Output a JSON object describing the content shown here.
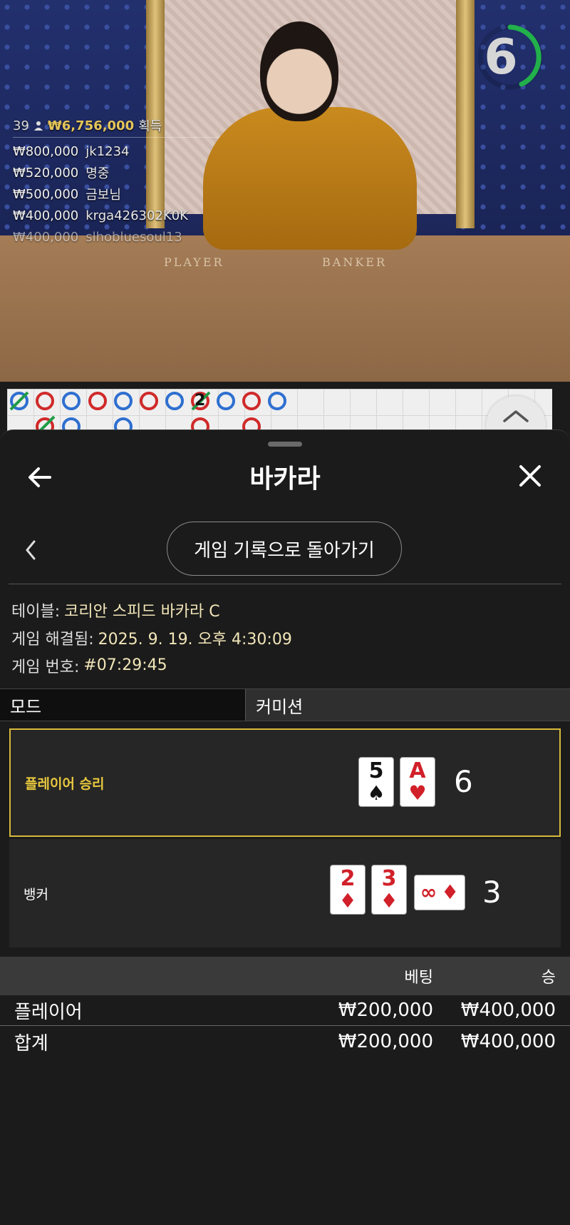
{
  "live": {
    "countdown": "6",
    "table_labels": {
      "player": "PLAYER",
      "banker": "BANKER"
    },
    "winners": {
      "count": "39",
      "total": "₩6,756,000",
      "suffix": "획득",
      "list": [
        {
          "amount": "₩800,000",
          "name": "jk1234"
        },
        {
          "amount": "₩520,000",
          "name": "명중"
        },
        {
          "amount": "₩500,000",
          "name": "금보님"
        },
        {
          "amount": "₩400,000",
          "name": "krga426302K0K"
        },
        {
          "amount": "₩400,000",
          "name": "slhobluesoul13"
        }
      ]
    }
  },
  "roadmap": {
    "marker_number": "2"
  },
  "sheet": {
    "title": "바카라",
    "back_to_history": "게임 기록으로 돌아가기",
    "meta": {
      "table_label": "테이블:",
      "table_value": "코리안 스피드 바카라 C",
      "resolved_label": "게임 해결됨:",
      "resolved_value": "2025. 9. 19. 오후 4:30:09",
      "game_no_label": "게임 번호:",
      "game_no_value": "#07:29:45"
    },
    "mode": {
      "left": "모드",
      "right": "커미션"
    },
    "hands": {
      "player": {
        "label": "플레이어 승리",
        "score": "6",
        "cards": [
          {
            "rank": "5",
            "suit": "♠"
          },
          {
            "rank": "A",
            "suit": "♥"
          }
        ]
      },
      "banker": {
        "label": "뱅커",
        "score": "3",
        "cards": [
          {
            "rank": "2",
            "suit": "♦"
          },
          {
            "rank": "3",
            "suit": "♦"
          },
          {
            "rank": "∞",
            "suit": "♦"
          }
        ]
      }
    },
    "bets": {
      "header_bet": "베팅",
      "header_win": "승",
      "rows": [
        {
          "name": "플레이어",
          "bet": "₩200,000",
          "win": "₩400,000"
        }
      ],
      "total": {
        "name": "합계",
        "bet": "₩200,000",
        "win": "₩400,000"
      }
    }
  },
  "colors": {
    "accent_gold": "#e9c93e",
    "road_player": "#2e6fd0",
    "road_banker": "#d02a2a",
    "road_tie": "#1f9b45",
    "countdown_ring": "#22b04b"
  },
  "icons": [
    "back-arrow-icon",
    "close-icon",
    "chevron-left-icon",
    "chevron-up-icon",
    "user-icon"
  ]
}
